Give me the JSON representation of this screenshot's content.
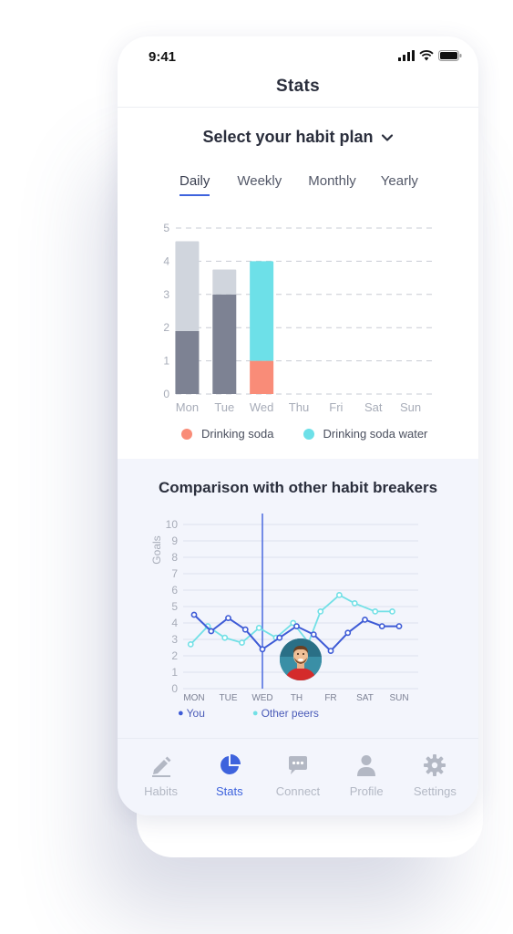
{
  "status_bar": {
    "time": "9:41"
  },
  "header": {
    "title": "Stats"
  },
  "plan_selector": {
    "label": "Select your habit plan"
  },
  "period_tabs": [
    {
      "label": "Daily",
      "active": true
    },
    {
      "label": "Weekly",
      "active": false
    },
    {
      "label": "Monthly",
      "active": false
    },
    {
      "label": "Yearly",
      "active": false
    }
  ],
  "colors": {
    "accent": "#3e63dd",
    "drinking_soda": "#f98c78",
    "drinking_soda_water": "#6de0e8",
    "bar_dark": "#7d8293",
    "bar_light": "#d0d5dd",
    "you_line": "#3e5bd6",
    "peers_line": "#72e0e6"
  },
  "chart_data": [
    {
      "type": "bar",
      "categories": [
        "Mon",
        "Tue",
        "Wed",
        "Thu",
        "Fri",
        "Sat",
        "Sun"
      ],
      "series": [
        {
          "name": "Drinking soda",
          "values": [
            1.9,
            3.0,
            1.0,
            0,
            0,
            0,
            0
          ]
        },
        {
          "name": "Drinking soda water",
          "values": [
            2.7,
            0.75,
            3.0,
            0,
            0,
            0,
            0
          ]
        }
      ],
      "ylim": [
        0,
        5
      ],
      "yticks": [
        "0",
        "1",
        "2",
        "3",
        "4",
        "5"
      ],
      "grid": true,
      "legend": "bottom"
    },
    {
      "type": "line",
      "title": "Comparison with other habit breakers",
      "ylabel": "Goals",
      "x": [
        "MON",
        "TUE",
        "WED",
        "TH",
        "FR",
        "SAT",
        "SUN"
      ],
      "ylim": [
        0,
        10
      ],
      "yticks": [
        "0",
        "1",
        "2",
        "3",
        "4",
        "5",
        "6",
        "7",
        "8",
        "9",
        "10"
      ],
      "series": [
        {
          "name": "You",
          "x": [
            0,
            0.5,
            1,
            1.5,
            2,
            2.5,
            3,
            3.5,
            4,
            4.5,
            5,
            5.5,
            6
          ],
          "values": [
            4.5,
            3.5,
            4.3,
            3.6,
            2.4,
            3.1,
            3.8,
            3.3,
            2.3,
            3.4,
            4.2,
            3.8,
            3.8
          ]
        },
        {
          "name": "Other peers",
          "x": [
            -0.1,
            0.4,
            0.9,
            1.4,
            1.9,
            2.4,
            2.9,
            3.35,
            3.7,
            4.25,
            4.7,
            5.3,
            5.8
          ],
          "values": [
            2.7,
            3.8,
            3.1,
            2.8,
            3.7,
            3.1,
            4.0,
            2.8,
            4.7,
            5.7,
            5.2,
            4.7,
            4.7
          ]
        }
      ],
      "marker_x": "WED",
      "legend": "bottom-left"
    }
  ],
  "tab_bar": [
    {
      "label": "Habits",
      "icon": "pencil-icon",
      "active": false
    },
    {
      "label": "Stats",
      "icon": "pie-chart-icon",
      "active": true
    },
    {
      "label": "Connect",
      "icon": "chat-icon",
      "active": false
    },
    {
      "label": "Profile",
      "icon": "person-icon",
      "active": false
    },
    {
      "label": "Settings",
      "icon": "gear-icon",
      "active": false
    }
  ]
}
